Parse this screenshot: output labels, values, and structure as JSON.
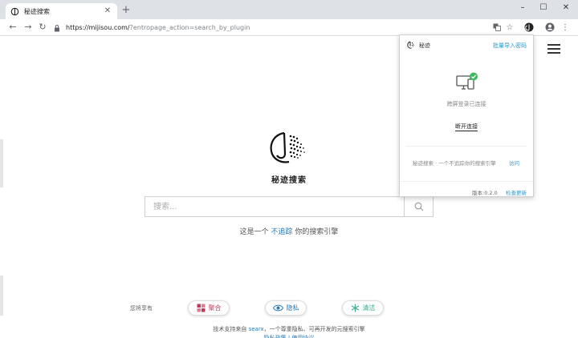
{
  "browser": {
    "tab_title": "秘迹搜索",
    "url_host": "https://mijisou.com/",
    "url_rest": "?entropage_action=search_by_plugin"
  },
  "page": {
    "brand": "秘迹搜索",
    "search_placeholder": "搜索...",
    "tagline_prefix": "这是一个 ",
    "tagline_link": "不追踪",
    "tagline_suffix": " 你的搜索引擎",
    "enjoy_label": "您将享有",
    "features": [
      {
        "label": "聚合",
        "color": "#c0395a"
      },
      {
        "label": "隐私",
        "color": "#2a7ab8"
      },
      {
        "label": "清洁",
        "color": "#3aa88c"
      }
    ],
    "footer_prefix": "技术支持来自 ",
    "footer_link": "searx",
    "footer_suffix": "，一个尊重隐私、可再开发的元搜索引擎",
    "footer_line2": "隐私政策 | 使用协议"
  },
  "popup": {
    "name": "秘迹",
    "import_link": "批量导入密码",
    "status": "跨屏登录已连接",
    "disconnect": "断开连接",
    "desc": "秘迹搜索 · 一个不追踪你的搜索引擎",
    "visit": "访问",
    "version": "版本:0.2.0",
    "update": "检查更新"
  },
  "colors": {
    "accent": "#2a9ad6",
    "link": "#2a7ab8",
    "connected": "#3cb95b"
  }
}
